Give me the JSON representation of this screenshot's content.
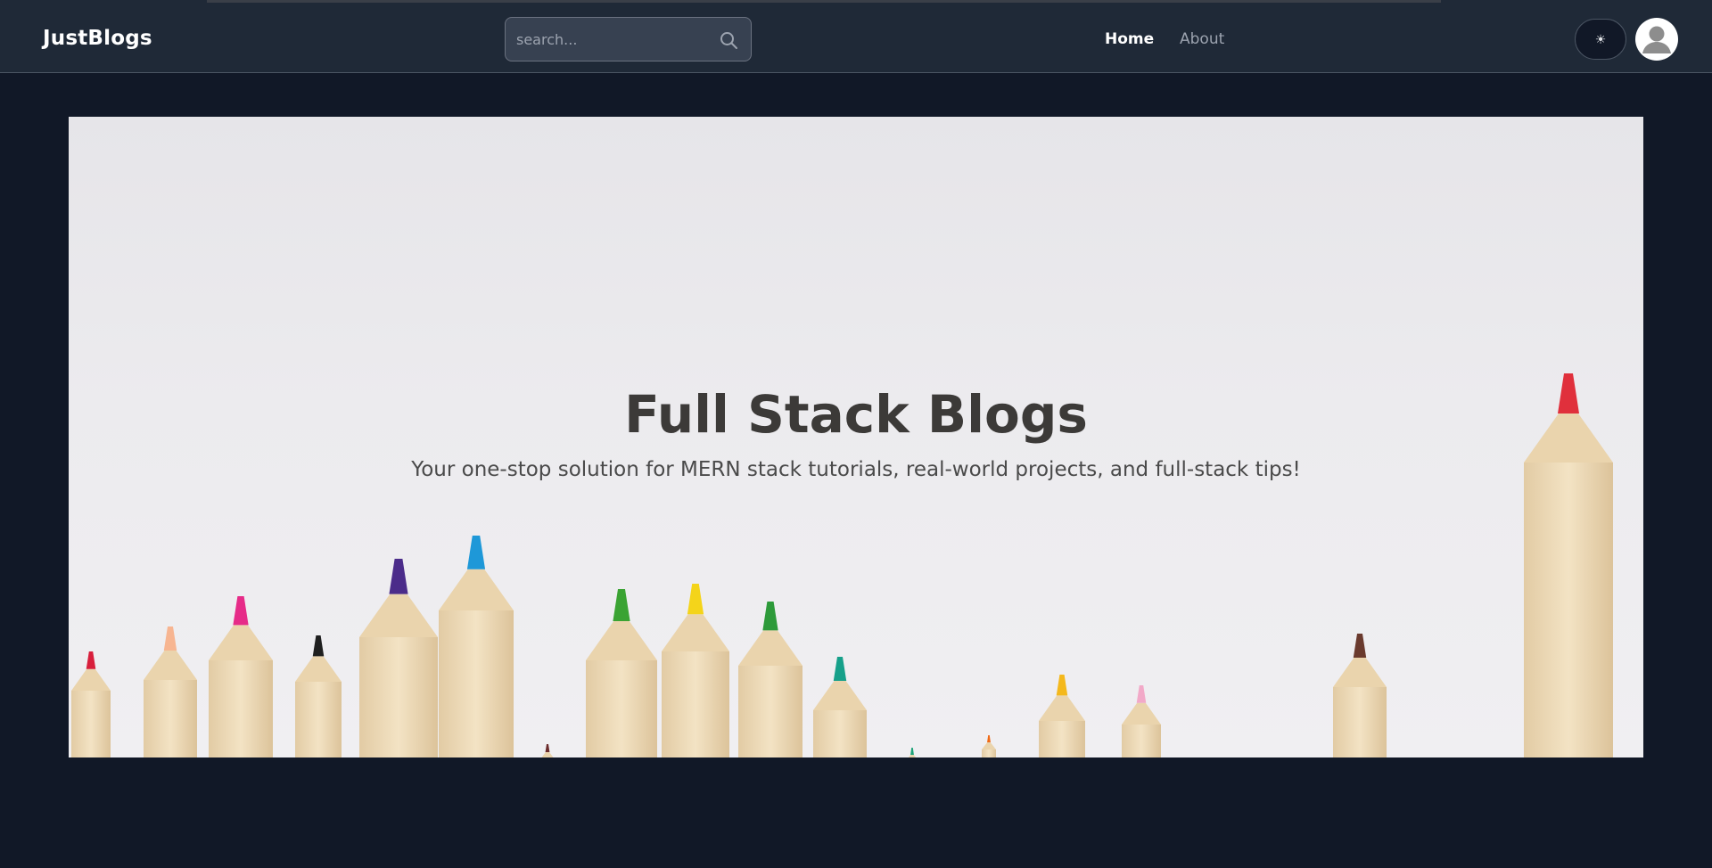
{
  "brand": {
    "name": "JustBlogs"
  },
  "search": {
    "placeholder": "search..."
  },
  "nav": {
    "home_label": "Home",
    "about_label": "About"
  },
  "theme_toggle": {
    "symbol": "☀"
  },
  "hero": {
    "title": "Full Stack Blogs",
    "subtitle": "Your one-stop solution for MERN stack tutorials, real-world projects, and full-stack tips!"
  },
  "colors": {
    "page_bg": "#111827",
    "navbar_bg": "#1f2937",
    "hero_bg": "#ececef",
    "title": "#3c3a38"
  },
  "hero_image": {
    "pencil_tip_colors": [
      "#d81f3c",
      "#f7b591",
      "#e62b88",
      "#1f1f1f",
      "#4b2c8a",
      "#1e98d8",
      "#6b2b2b",
      "#3aa333",
      "#f4d41a",
      "#2d9a3a",
      "#16a08a",
      "#1ea378",
      "#f06a16",
      "#f4b81c",
      "#f2a9c8",
      "#6a3a2e",
      "#e0303c"
    ]
  }
}
